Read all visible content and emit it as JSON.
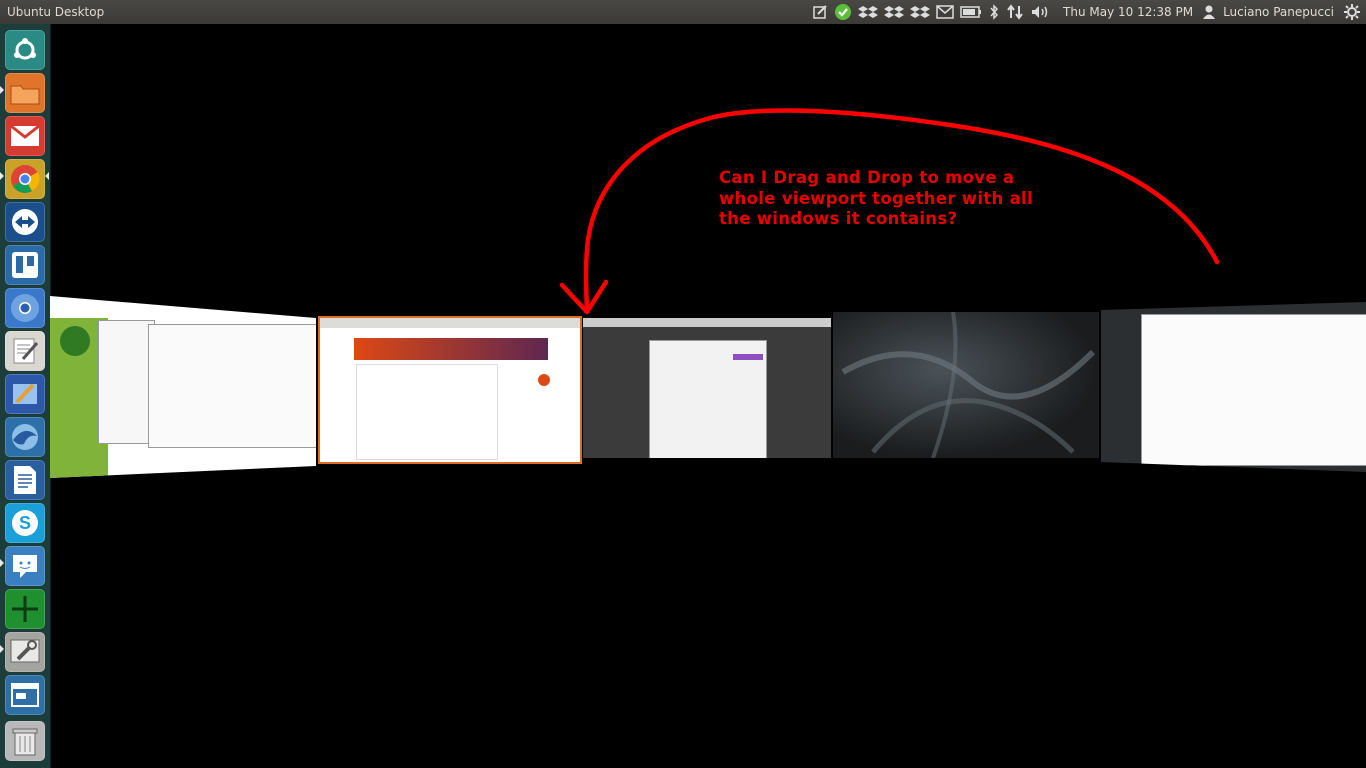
{
  "panel": {
    "app_title": "Ubuntu Desktop",
    "clock": "Thu May 10 12:38 PM",
    "user": "Luciano Panepucci",
    "indicators": [
      "notes-icon",
      "check-sync-icon",
      "dropbox-icon",
      "dropbox-icon",
      "dropbox-icon",
      "mail-icon",
      "battery-icon",
      "bluetooth-icon",
      "network-icon",
      "volume-icon",
      "user-icon",
      "gear-icon"
    ]
  },
  "launcher": {
    "items": [
      {
        "name": "dash-home",
        "icon": "ubuntu-logo-icon",
        "color": "#2a8a84"
      },
      {
        "name": "files",
        "icon": "folder-icon",
        "color": "#e0742a"
      },
      {
        "name": "gmail",
        "icon": "gmail-icon",
        "color": "#d63b31"
      },
      {
        "name": "chrome",
        "icon": "chrome-icon",
        "color": "#c9a227"
      },
      {
        "name": "teamviewer",
        "icon": "teamviewer-icon",
        "color": "#1b4f8c"
      },
      {
        "name": "trello",
        "icon": "trello-icon",
        "color": "#2a6aa6"
      },
      {
        "name": "chromium",
        "icon": "chromium-icon",
        "color": "#3a78c9"
      },
      {
        "name": "text-editor",
        "icon": "text-editor-icon",
        "color": "#d8d8d0"
      },
      {
        "name": "drawing",
        "icon": "drawing-icon",
        "color": "#2d58a8"
      },
      {
        "name": "thunderbird",
        "icon": "thunderbird-icon",
        "color": "#2d6fa8"
      },
      {
        "name": "writer",
        "icon": "writer-icon",
        "color": "#2a5f9e"
      },
      {
        "name": "skype",
        "icon": "skype-icon",
        "color": "#1b9fd8"
      },
      {
        "name": "empathy",
        "icon": "chat-icon",
        "color": "#3a7fbf"
      },
      {
        "name": "workspace-switcher",
        "icon": "workspace-icon",
        "color": "#1f8f2f"
      },
      {
        "name": "system-settings",
        "icon": "settings-icon",
        "color": "#a4a4a0"
      },
      {
        "name": "window-manager",
        "icon": "window-icon",
        "color": "#2e6fa6"
      },
      {
        "name": "trash",
        "icon": "trash-icon",
        "color": "#b8b8b8"
      }
    ]
  },
  "annotation": {
    "text": "Can I Drag and Drop to move a whole viewport together with all the windows it contains?",
    "color": "#e80000"
  },
  "accent": {
    "highlight": "#dd6d22",
    "arrow": "#ff0000"
  }
}
